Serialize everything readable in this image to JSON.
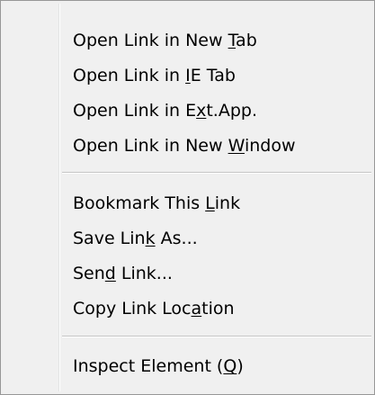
{
  "menu": {
    "groups": [
      [
        {
          "pre": "Open Link in New ",
          "key": "T",
          "post": "ab"
        },
        {
          "pre": "Open Link in ",
          "key": "I",
          "post": "E Tab"
        },
        {
          "pre": "Open Link in E",
          "key": "x",
          "post": "t.App."
        },
        {
          "pre": "Open Link in New ",
          "key": "W",
          "post": "indow"
        }
      ],
      [
        {
          "pre": "Bookmark This ",
          "key": "L",
          "post": "ink"
        },
        {
          "pre": "Save Lin",
          "key": "k",
          "post": " As..."
        },
        {
          "pre": "Sen",
          "key": "d",
          "post": " Link..."
        },
        {
          "pre": "Copy Link Loc",
          "key": "a",
          "post": "tion"
        }
      ],
      [
        {
          "pre": "Inspect Element (",
          "key": "Q",
          "post": ")"
        }
      ]
    ]
  },
  "colors": {
    "background": "#f0f0f0",
    "border": "#979797",
    "text": "#000000",
    "separator": "#c5c5c5"
  }
}
